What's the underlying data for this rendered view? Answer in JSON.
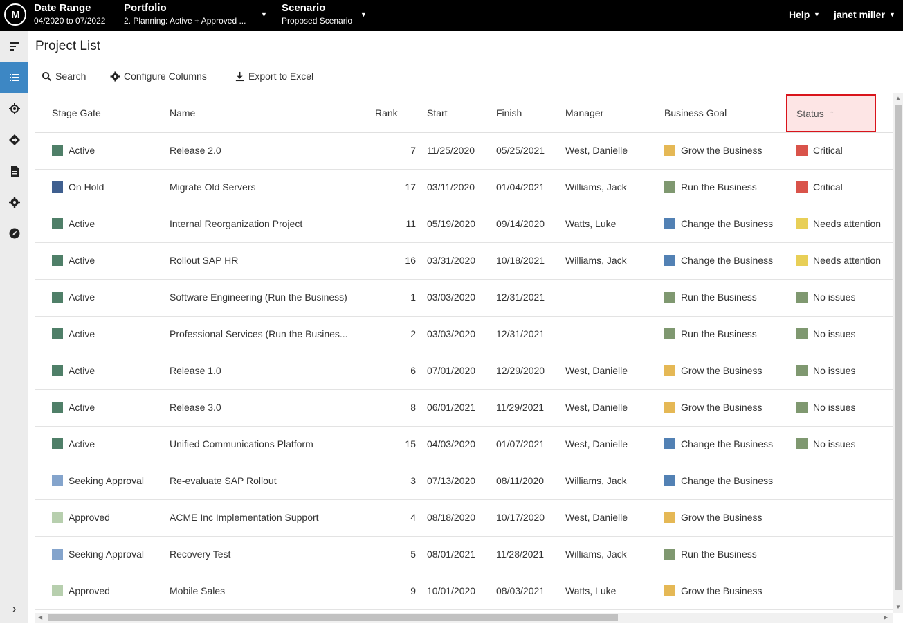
{
  "topbar": {
    "logo": "M",
    "date_range": {
      "title": "Date Range",
      "value": "04/2020 to 07/2022"
    },
    "portfolio": {
      "title": "Portfolio",
      "value": "2. Planning: Active + Approved ..."
    },
    "scenario": {
      "title": "Scenario",
      "value": "Proposed Scenario"
    },
    "help": "Help",
    "user": "janet miller"
  },
  "sidebar": {
    "items": [
      "menu-collapse-icon",
      "list-icon",
      "target-icon",
      "roadmap-icon",
      "document-icon",
      "gear-icon",
      "compass-icon"
    ],
    "expand": "›"
  },
  "page": {
    "title": "Project List"
  },
  "toolbar": {
    "search": "Search",
    "configure": "Configure Columns",
    "export": "Export to Excel"
  },
  "columns": {
    "stage_gate": "Stage Gate",
    "name": "Name",
    "rank": "Rank",
    "start": "Start",
    "finish": "Finish",
    "manager": "Manager",
    "goal": "Business Goal",
    "status": "Status",
    "sort_arrow": "↑"
  },
  "colors": {
    "Active": "#4f7f68",
    "On Hold": "#3f5f8f",
    "Seeking Approval": "#84a4cc",
    "Approved": "#b7cfae",
    "Grow the Business": "#e5b855",
    "Run the Business": "#7f9870",
    "Change the Business": "#5281b4",
    "Critical": "#d9534a",
    "Needs attention": "#e8cf57",
    "No issues": "#7f9870"
  },
  "rows": [
    {
      "stage": "Active",
      "name": "Release 2.0",
      "rank": "7",
      "start": "11/25/2020",
      "finish": "05/25/2021",
      "manager": "West, Danielle",
      "goal": "Grow the Business",
      "status": "Critical"
    },
    {
      "stage": "On Hold",
      "name": "Migrate Old Servers",
      "rank": "17",
      "start": "03/11/2020",
      "finish": "01/04/2021",
      "manager": "Williams, Jack",
      "goal": "Run the Business",
      "status": "Critical"
    },
    {
      "stage": "Active",
      "name": "Internal Reorganization Project",
      "rank": "11",
      "start": "05/19/2020",
      "finish": "09/14/2020",
      "manager": "Watts, Luke",
      "goal": "Change the Business",
      "status": "Needs attention"
    },
    {
      "stage": "Active",
      "name": "Rollout SAP HR",
      "rank": "16",
      "start": "03/31/2020",
      "finish": "10/18/2021",
      "manager": "Williams, Jack",
      "goal": "Change the Business",
      "status": "Needs attention"
    },
    {
      "stage": "Active",
      "name": "Software Engineering (Run the Business)",
      "rank": "1",
      "start": "03/03/2020",
      "finish": "12/31/2021",
      "manager": "",
      "goal": "Run the Business",
      "status": "No issues"
    },
    {
      "stage": "Active",
      "name": "Professional Services (Run the Busines...",
      "rank": "2",
      "start": "03/03/2020",
      "finish": "12/31/2021",
      "manager": "",
      "goal": "Run the Business",
      "status": "No issues"
    },
    {
      "stage": "Active",
      "name": "Release 1.0",
      "rank": "6",
      "start": "07/01/2020",
      "finish": "12/29/2020",
      "manager": "West, Danielle",
      "goal": "Grow the Business",
      "status": "No issues"
    },
    {
      "stage": "Active",
      "name": "Release 3.0",
      "rank": "8",
      "start": "06/01/2021",
      "finish": "11/29/2021",
      "manager": "West, Danielle",
      "goal": "Grow the Business",
      "status": "No issues"
    },
    {
      "stage": "Active",
      "name": "Unified Communications Platform",
      "rank": "15",
      "start": "04/03/2020",
      "finish": "01/07/2021",
      "manager": "West, Danielle",
      "goal": "Change the Business",
      "status": "No issues"
    },
    {
      "stage": "Seeking Approval",
      "name": "Re-evaluate SAP Rollout",
      "rank": "3",
      "start": "07/13/2020",
      "finish": "08/11/2020",
      "manager": "Williams, Jack",
      "goal": "Change the Business",
      "status": ""
    },
    {
      "stage": "Approved",
      "name": "ACME Inc Implementation Support",
      "rank": "4",
      "start": "08/18/2020",
      "finish": "10/17/2020",
      "manager": "West, Danielle",
      "goal": "Grow the Business",
      "status": ""
    },
    {
      "stage": "Seeking Approval",
      "name": "Recovery Test",
      "rank": "5",
      "start": "08/01/2021",
      "finish": "11/28/2021",
      "manager": "Williams, Jack",
      "goal": "Run the Business",
      "status": ""
    },
    {
      "stage": "Approved",
      "name": "Mobile Sales",
      "rank": "9",
      "start": "10/01/2020",
      "finish": "08/03/2021",
      "manager": "Watts, Luke",
      "goal": "Grow the Business",
      "status": ""
    }
  ]
}
